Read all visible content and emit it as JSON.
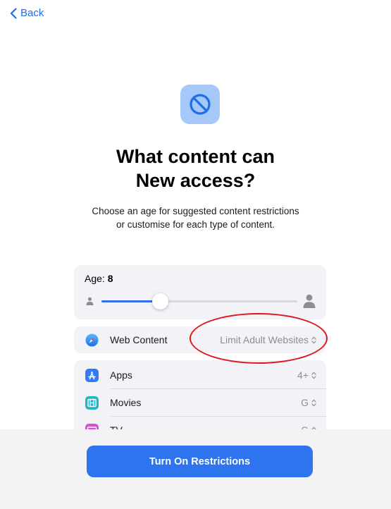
{
  "nav": {
    "back_label": "Back"
  },
  "header": {
    "icon": "restrictions-circle-slash-icon",
    "title_line1": "What content can",
    "title_line2": "New access?",
    "subtitle_line1": "Choose an age for suggested content restrictions",
    "subtitle_line2": "or customise for each type of content."
  },
  "age": {
    "label": "Age:",
    "value": "8",
    "slider_fraction": 0.3
  },
  "web_content": {
    "icon": "safari-compass-icon",
    "label": "Web Content",
    "value": "Limit Adult Websites"
  },
  "content_types": [
    {
      "icon": "app-store-icon",
      "label": "Apps",
      "value": "4+"
    },
    {
      "icon": "movies-film-icon",
      "label": "Movies",
      "value": "G"
    },
    {
      "icon": "tv-icon",
      "label": "TV",
      "value": "G"
    }
  ],
  "footer": {
    "button_label": "Turn On Restrictions"
  },
  "colors": {
    "accent": "#2D74EE",
    "annotation": "#E0161E",
    "card_bg": "#F2F2F7"
  }
}
